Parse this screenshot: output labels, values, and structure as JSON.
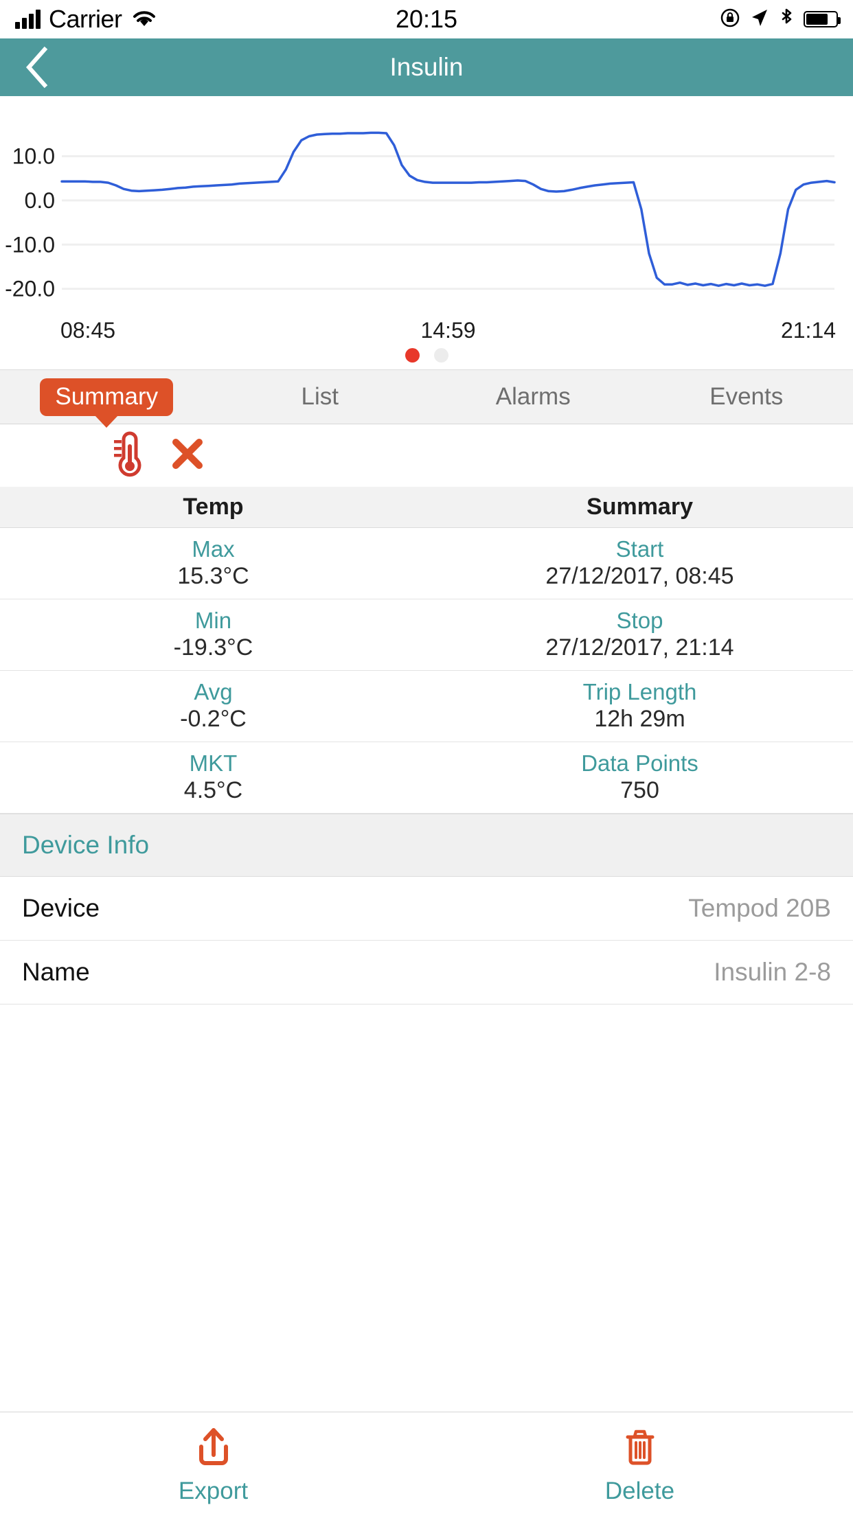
{
  "status_bar": {
    "carrier": "Carrier",
    "time": "20:15",
    "icons": [
      "signal-bars-icon",
      "wifi-icon",
      "rotation-lock-icon",
      "location-arrow-icon",
      "bluetooth-icon",
      "battery-icon"
    ]
  },
  "nav": {
    "title": "Insulin",
    "back_icon": "chevron-left-icon"
  },
  "chart_data": {
    "type": "line",
    "title": "",
    "xlabel": "",
    "ylabel": "",
    "series_name": "Temperature",
    "line_color": "#2f5ed8",
    "grid": true,
    "legend": "none",
    "ylim": [
      -23.0,
      18.0
    ],
    "yticks": [
      10.0,
      0.0,
      -10.0,
      -20.0
    ],
    "ytick_labels": [
      "10.0",
      "0.0",
      "-10.0",
      "-20.0"
    ],
    "xticks": [
      "08:45",
      "14:59",
      "21:14"
    ],
    "xtick_labels": [
      "08:45",
      "14:59",
      "21:14"
    ],
    "x": [
      0,
      1,
      2,
      3,
      4,
      5,
      6,
      7,
      8,
      9,
      10,
      11,
      12,
      13,
      14,
      15,
      16,
      17,
      18,
      19,
      20,
      21,
      22,
      23,
      24,
      25,
      26,
      27,
      28,
      29,
      30,
      31,
      32,
      33,
      34,
      35,
      36,
      37,
      38,
      39,
      40,
      41,
      42,
      43,
      44,
      45,
      46,
      47,
      48,
      49,
      50,
      51,
      52,
      53,
      54,
      55,
      56,
      57,
      58,
      59,
      60,
      61,
      62,
      63,
      64,
      65,
      66,
      67,
      68,
      69,
      70,
      71,
      72,
      73,
      74,
      75,
      76,
      77,
      78,
      79,
      80,
      81,
      82,
      83,
      84,
      85,
      86,
      87,
      88,
      89,
      90,
      91,
      92,
      93,
      94,
      95,
      96,
      97,
      98,
      99,
      100
    ],
    "values": [
      4.3,
      4.3,
      4.3,
      4.3,
      4.2,
      4.2,
      4.0,
      3.4,
      2.6,
      2.2,
      2.1,
      2.2,
      2.3,
      2.4,
      2.6,
      2.8,
      2.9,
      3.1,
      3.2,
      3.3,
      3.4,
      3.5,
      3.6,
      3.8,
      3.9,
      4.0,
      4.1,
      4.2,
      4.3,
      7.0,
      11.0,
      13.6,
      14.5,
      14.9,
      15.0,
      15.1,
      15.1,
      15.2,
      15.2,
      15.2,
      15.3,
      15.3,
      15.2,
      12.5,
      8.0,
      5.6,
      4.6,
      4.2,
      4.0,
      4.0,
      4.0,
      4.0,
      4.0,
      4.0,
      4.1,
      4.1,
      4.2,
      4.3,
      4.4,
      4.5,
      4.4,
      3.6,
      2.6,
      2.1,
      2.0,
      2.1,
      2.4,
      2.8,
      3.1,
      3.4,
      3.6,
      3.8,
      3.9,
      4.0,
      4.1,
      -2.0,
      -12.0,
      -17.5,
      -19.0,
      -19.0,
      -18.6,
      -19.1,
      -18.8,
      -19.2,
      -18.9,
      -19.3,
      -18.9,
      -19.2,
      -18.8,
      -19.2,
      -19.0,
      -19.3,
      -18.9,
      -12.0,
      -2.0,
      2.4,
      3.6,
      4.0,
      4.2,
      4.4,
      4.1
    ],
    "pager": {
      "pages": 2,
      "active_index": 0,
      "active_color": "#e8382a",
      "inactive_color": "#ececec"
    }
  },
  "tabs": [
    {
      "label": "Summary",
      "active": true
    },
    {
      "label": "List",
      "active": false
    },
    {
      "label": "Alarms",
      "active": false
    },
    {
      "label": "Events",
      "active": false
    }
  ],
  "status_icons": {
    "thermometer": "thermometer-icon",
    "alarm_x": "x-mark-icon"
  },
  "summary": {
    "headers": [
      "Temp",
      "Summary"
    ],
    "rows": [
      {
        "left_label": "Max",
        "left_value": "15.3°C",
        "right_label": "Start",
        "right_value": "27/12/2017, 08:45"
      },
      {
        "left_label": "Min",
        "left_value": "-19.3°C",
        "right_label": "Stop",
        "right_value": "27/12/2017, 21:14"
      },
      {
        "left_label": "Avg",
        "left_value": "-0.2°C",
        "right_label": "Trip Length",
        "right_value": "12h 29m"
      },
      {
        "left_label": "MKT",
        "left_value": "4.5°C",
        "right_label": "Data Points",
        "right_value": "750"
      }
    ]
  },
  "device_info": {
    "section_title": "Device Info",
    "rows": [
      {
        "key": "Device",
        "value": "Tempod 20B"
      },
      {
        "key": "Name",
        "value": "Insulin 2-8"
      }
    ]
  },
  "footer": {
    "export": {
      "label": "Export",
      "icon": "upload-icon"
    },
    "delete": {
      "label": "Delete",
      "icon": "trash-icon"
    }
  },
  "colors": {
    "nav_bg": "#4e9a9c",
    "accent_teal": "#3f9a9c",
    "accent_orange": "#dd5128",
    "chart_line": "#2f5ed8"
  }
}
